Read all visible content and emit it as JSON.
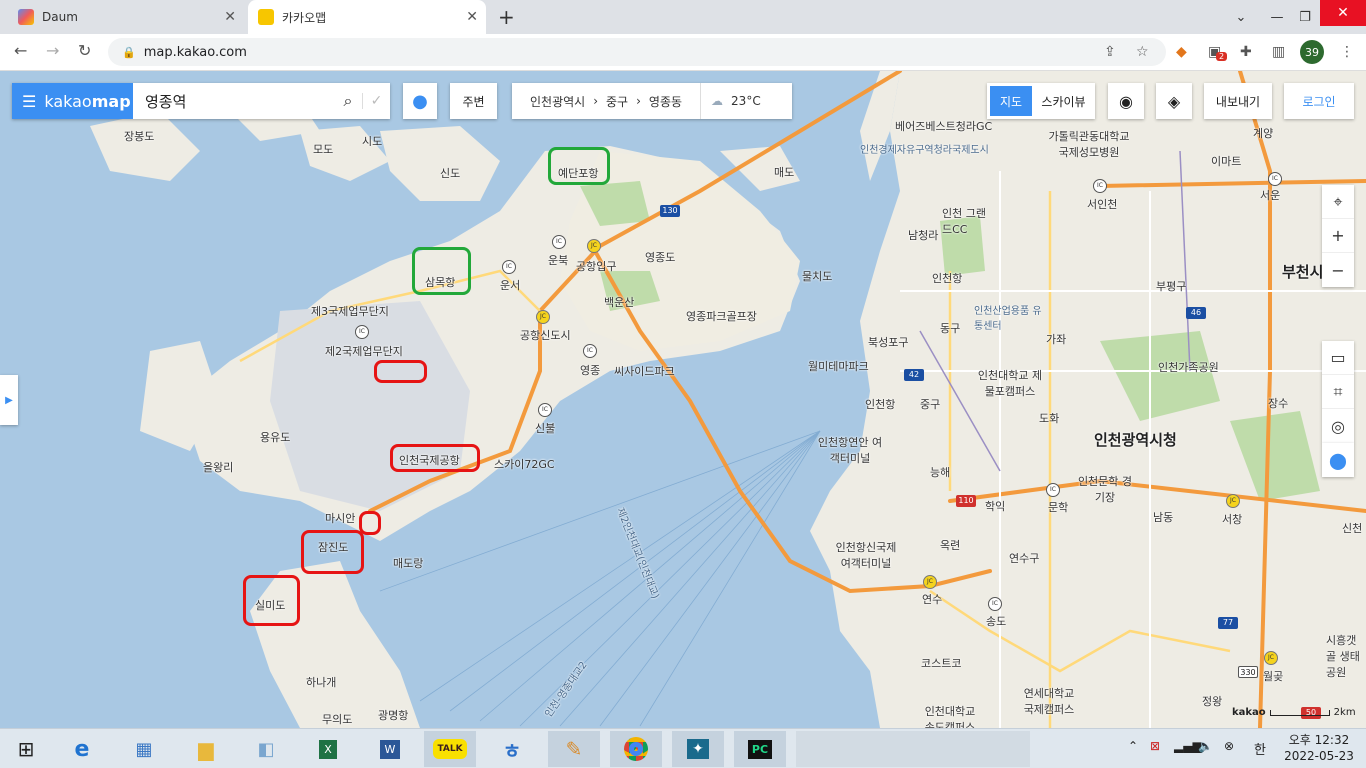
{
  "browser": {
    "tabs": [
      {
        "title": "Daum",
        "favicon_color": "#5b8cf0"
      },
      {
        "title": "카카오맵",
        "favicon_color": "#f7c600"
      }
    ],
    "url": "map.kakao.com",
    "extension_badge": "2",
    "profile_count": "39"
  },
  "map_ui": {
    "logo_kakao": "kakao",
    "logo_map": "map",
    "search_query": "영종역",
    "nearby_label": "주변",
    "breadcrumb": [
      "인천광역시",
      "중구",
      "영종동"
    ],
    "weather": "23°C",
    "view_modes": [
      "지도",
      "스카이뷰"
    ],
    "export_label": "내보내기",
    "login_label": "로그인",
    "scale_brand": "kakao",
    "scale_label": "2km"
  },
  "labels": {
    "jangbong": "장봉도",
    "modo": "모도",
    "sido": "시도",
    "sindo": "신도",
    "yedanpo": "예단포항",
    "maedo": "매도",
    "sammok": "삼목항",
    "unbuk": "운북",
    "airport_entrance": "공항입구",
    "yeongjongdo": "영종도",
    "unseo": "운서",
    "baegunsan": "백운산",
    "mulchido": "물치도",
    "ind3": "제3국제업무단지",
    "ind2": "제2국제업무단지",
    "airport_newtown": "공항신도시",
    "yeongjong": "영종",
    "golf_park": "영종파크골프장",
    "seaside": "씨사이드파크",
    "yongyudo": "용유도",
    "eulwangri": "을왕리",
    "sinbul": "신불",
    "airport": "인천국제공항",
    "sky72": "스카이72GC",
    "masian": "마시안",
    "jamjindo": "잠진도",
    "maedorang": "매도랑",
    "silmido": "실미도",
    "hanagae": "하나개",
    "muuido": "무의도",
    "gwangmyeong": "광명항",
    "bridge_no2": "제2인천대교(인천대교)",
    "bridge2": "인천-영종대교2",
    "bestsheong": "베어즈베스트청라GC",
    "freeport": "인천경제자유구역청라국제도시",
    "catholic_hospital": "가톨릭관동대학교 국제성모병원",
    "geyang": "계양",
    "emart": "이마트",
    "seoincheon": "서인천",
    "seowoon": "서운",
    "grand_cc": "인천 그랜드CC",
    "namcheongna": "남청라",
    "incheon_port": "인천항",
    "bupyeong_si": "부천시",
    "bupyeong_gu": "부평구",
    "industrial_complex": "인천산업용품 유통센터",
    "donggu": "동구",
    "north_port": "북성포구",
    "gajwa": "가좌",
    "wolmi": "월미테마파크",
    "inha_univ": "인천대학교 제물포캠퍼스",
    "family_park": "인천가족공원",
    "jangsu": "장수",
    "incheon_station": "인천항",
    "junggu": "중구",
    "dohwa": "도화",
    "city_hall": "인천광역시청",
    "terminal_inland": "인천항연안 여객터미널",
    "neunghae": "능해",
    "munhak": "문학",
    "munhak_stadium": "인천문학 경기장",
    "hakik": "학익",
    "namdong": "남동",
    "seochang": "서창",
    "terminal_intl": "인천항신국제 여객터미널",
    "okryeon": "옥련",
    "yeonsugu": "연수구",
    "yeonsu": "연수",
    "songdo": "송도",
    "costco": "코스트코",
    "yonsei": "연세대학교 국제캠퍼스",
    "inu_songdo": "인천대학교 송도캠퍼스",
    "siheung": "시흥갯골 생태공원",
    "wolgot": "월곶",
    "jeongwang": "정왕",
    "sinchon": "신천"
  },
  "shields": [
    "130",
    "42",
    "46",
    "110",
    "77",
    "330",
    "50"
  ],
  "taskbar": {
    "apps": [
      "ie-icon",
      "control-panel-icon",
      "explorer-icon",
      "notepad-icon",
      "excel-icon",
      "word-icon",
      "kakaotalk-icon",
      "hangul-icon",
      "paint-icon",
      "chrome-icon",
      "photos-icon",
      "pycharm-icon"
    ],
    "kakao_talk_label": "TALK",
    "ime": "한",
    "time": "오후 12:32",
    "date": "2022-05-23"
  },
  "colors": {
    "accent": "#3b8ff2",
    "highlight_red": "#e61414",
    "highlight_green": "#22a83a",
    "sea": "#a9c8e3",
    "land": "#eeece4",
    "road": "#f39a3d"
  }
}
